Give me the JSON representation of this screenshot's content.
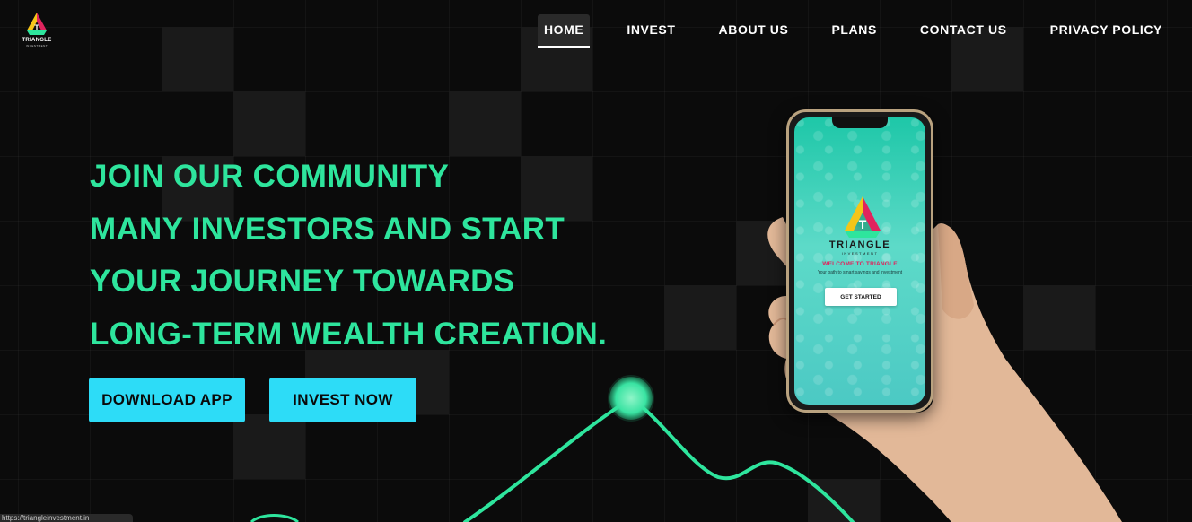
{
  "brand": {
    "name": "TRIANGLE",
    "sub": "INVESTMENT"
  },
  "nav": {
    "items": [
      {
        "label": "HOME",
        "active": true
      },
      {
        "label": "INVEST"
      },
      {
        "label": "ABOUT US"
      },
      {
        "label": "PLANS"
      },
      {
        "label": "CONTACT US"
      },
      {
        "label": "PRIVACY POLICY"
      }
    ]
  },
  "hero": {
    "lines": [
      "JOIN OUR COMMUNITY",
      "MANY INVESTORS AND START",
      "YOUR JOURNEY TOWARDS",
      "LONG-TERM WEALTH CREATION."
    ],
    "download_label": "DOWNLOAD APP",
    "invest_label": "INVEST NOW"
  },
  "phone": {
    "brand": "TRIANGLE",
    "brand_sub": "INVESTMENT",
    "welcome": "WELCOME TO TRIANGLE",
    "tagline": "Your path to smart savings and investment",
    "cta": "GET STARTED"
  },
  "status_bar": {
    "url": "https://triangleinvestment.in"
  },
  "colors": {
    "accent_green": "#2ee59d",
    "button_cyan": "#2ddcf7",
    "background": "#0b0b0b",
    "welcome_pink": "#e0245e"
  }
}
